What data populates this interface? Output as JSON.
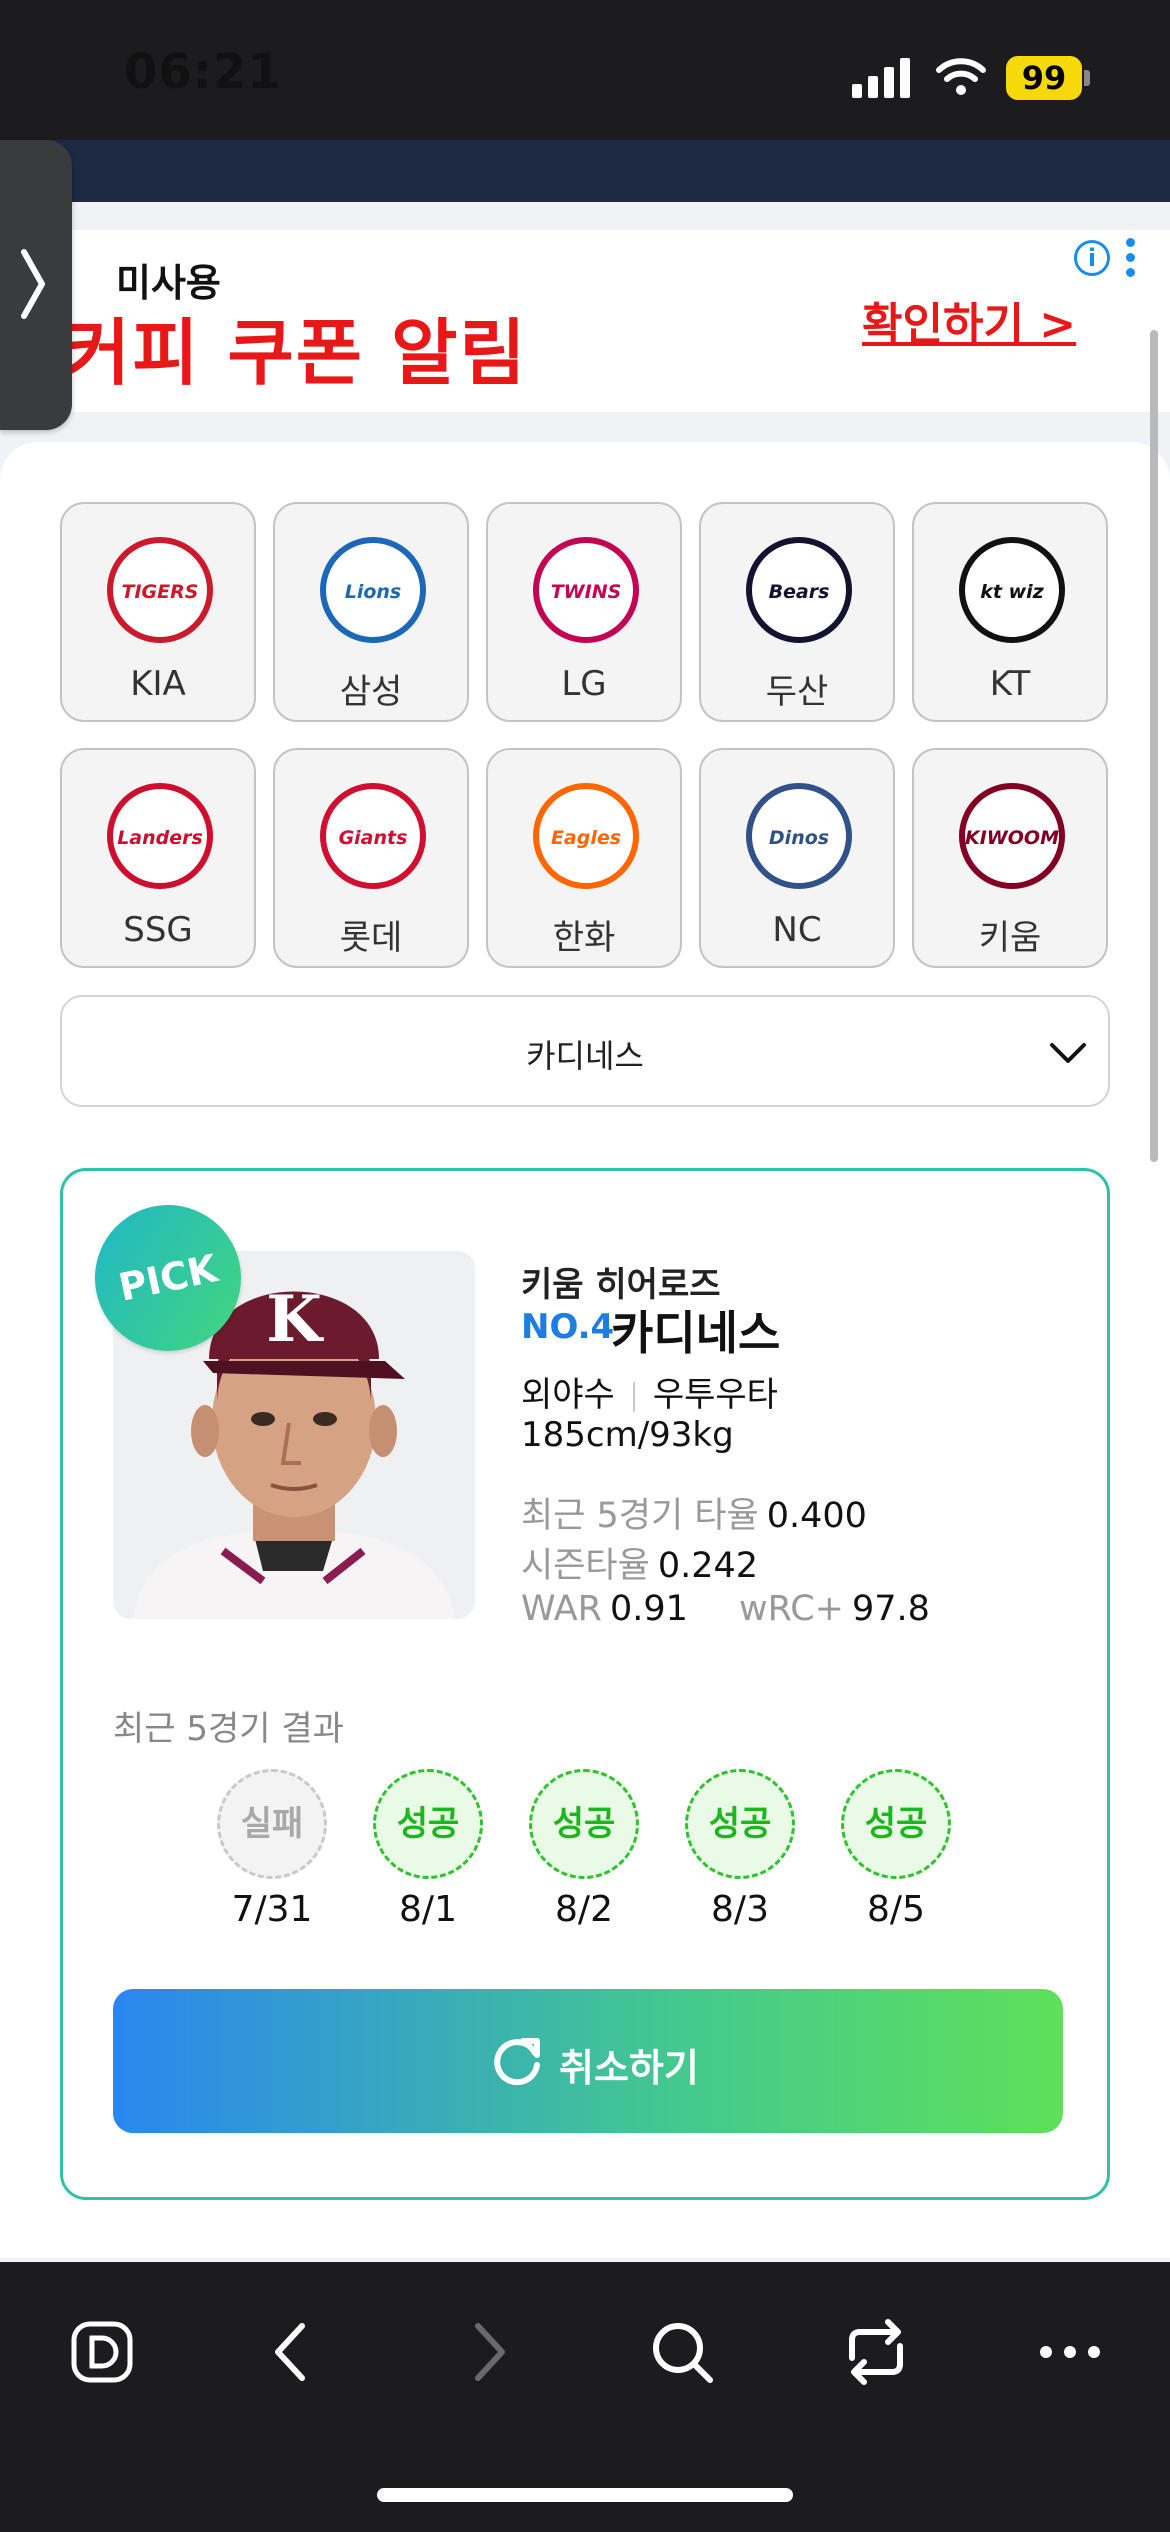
{
  "status_bar": {
    "time": "06:21",
    "battery": "99"
  },
  "ad": {
    "subtitle": "미사용",
    "title": "커피 쿠폰 알림",
    "cta": "확인하기 >"
  },
  "teams": [
    {
      "name": "KIA",
      "logo_text": "TIGERS",
      "color": "#cc1a2b"
    },
    {
      "name": "삼성",
      "logo_text": "Lions",
      "color": "#1b67b8"
    },
    {
      "name": "LG",
      "logo_text": "TWINS",
      "color": "#c30452"
    },
    {
      "name": "두산",
      "logo_text": "Bears",
      "color": "#131230"
    },
    {
      "name": "KT",
      "logo_text": "kt wiz",
      "color": "#111111"
    },
    {
      "name": "SSG",
      "logo_text": "Landers",
      "color": "#ce0e2d"
    },
    {
      "name": "롯데",
      "logo_text": "Giants",
      "color": "#d00f31"
    },
    {
      "name": "한화",
      "logo_text": "Eagles",
      "color": "#ff6600"
    },
    {
      "name": "NC",
      "logo_text": "Dinos",
      "color": "#315288"
    },
    {
      "name": "키움",
      "logo_text": "KIWOOM",
      "color": "#820024"
    }
  ],
  "dropdown": {
    "selected": "카디네스"
  },
  "player": {
    "badge": "PICK",
    "team": "키움 히어로즈",
    "number": "NO.4",
    "name": "카디네스",
    "position": "외야수",
    "bats_throws": "우투우타",
    "body": "185cm/93kg",
    "stats": {
      "recent_label": "최근 5경기 타율",
      "recent_value": "0.400",
      "season_label": "시즌타율",
      "season_value": "0.242",
      "war_label": "WAR",
      "war_value": "0.91",
      "wrc_label": "wRC+",
      "wrc_value": "97.8"
    }
  },
  "recent_results": {
    "label": "최근 5경기 결과",
    "games": [
      {
        "result": "실패",
        "date": "7/31",
        "success": false
      },
      {
        "result": "성공",
        "date": "8/1",
        "success": true
      },
      {
        "result": "성공",
        "date": "8/2",
        "success": true
      },
      {
        "result": "성공",
        "date": "8/3",
        "success": true
      },
      {
        "result": "성공",
        "date": "8/5",
        "success": true
      }
    ]
  },
  "cancel_button": {
    "label": "취소하기"
  },
  "toolbar": {
    "icons": [
      "d-icon",
      "back-icon",
      "forward-icon",
      "search-icon",
      "tabs-icon",
      "more-icon"
    ]
  }
}
